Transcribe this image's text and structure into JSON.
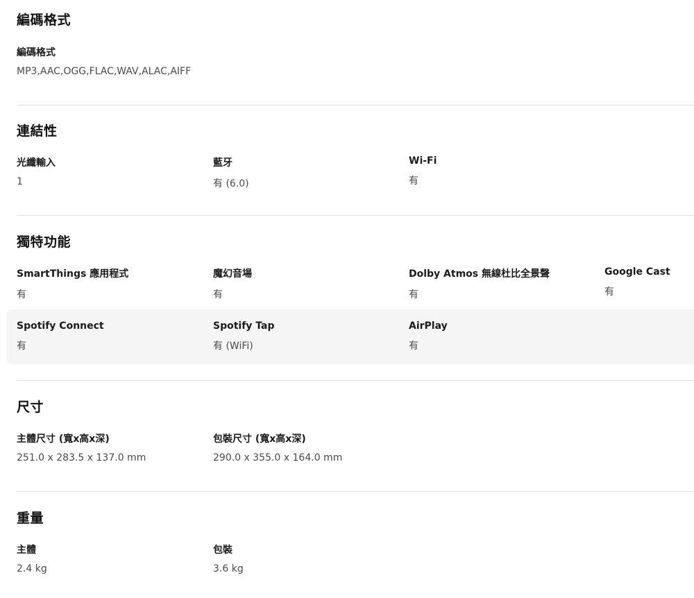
{
  "sections": {
    "codec": {
      "title": "編碼格式",
      "specs": [
        {
          "label": "編碼格式",
          "value": "MP3,AAC,OGG,FLAC,WAV,ALAC,AIFF"
        }
      ]
    },
    "connectivity": {
      "title": "連結性",
      "specs": [
        {
          "label": "光纖輸入",
          "value": "1"
        },
        {
          "label": "藍牙",
          "value": "有 (6.0)"
        },
        {
          "label": "Wi-Fi",
          "value": "有"
        }
      ]
    },
    "features": {
      "title": "獨特功能",
      "specs": [
        {
          "label": "SmartThings 應用程式",
          "value": "有"
        },
        {
          "label": "魔幻音場",
          "value": "有"
        },
        {
          "label": "Dolby Atmos 無線杜比全景聲",
          "value": "有"
        },
        {
          "label": "Google Cast",
          "value": "有"
        },
        {
          "label": "Spotify Connect",
          "value": "有"
        },
        {
          "label": "Spotify Tap",
          "value": "有 (WiFi)"
        },
        {
          "label": "AirPlay",
          "value": "有"
        }
      ]
    },
    "dimensions": {
      "title": "尺寸",
      "specs": [
        {
          "label": "主體尺寸 (寬x高x深)",
          "value": "251.0 x 283.5 x 137.0 mm"
        },
        {
          "label": "包裝尺寸 (寬x高x深)",
          "value": "290.0 x 355.0 x 164.0 mm"
        }
      ]
    },
    "weight": {
      "title": "重量",
      "specs": [
        {
          "label": "主體",
          "value": "2.4 kg"
        },
        {
          "label": "包裝",
          "value": "3.6 kg"
        }
      ]
    }
  }
}
